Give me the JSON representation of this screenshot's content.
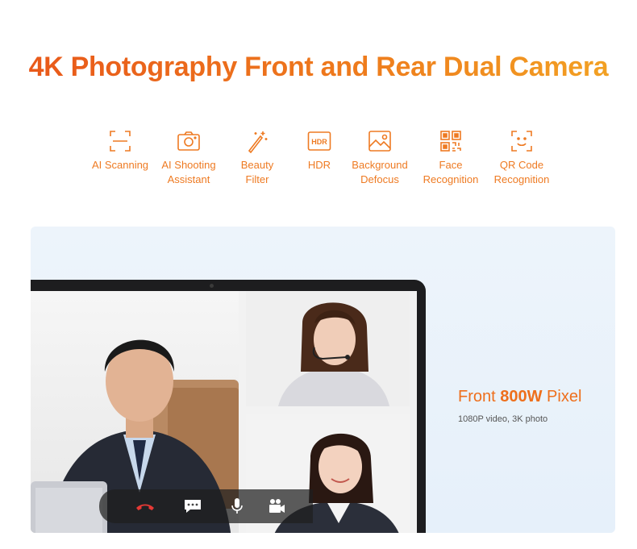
{
  "heading": "4K Photography Front and Rear Dual Camera",
  "features": [
    {
      "line1": "AI Scanning",
      "line2": "",
      "icon": "scan-frame-icon"
    },
    {
      "line1": "AI Shooting",
      "line2": "Assistant",
      "icon": "camera-icon"
    },
    {
      "line1": "Beauty",
      "line2": "Filter",
      "icon": "magic-wand-icon"
    },
    {
      "line1": "HDR",
      "line2": "",
      "icon": "hdr-icon"
    },
    {
      "line1": "Background",
      "line2": "Defocus",
      "icon": "landscape-photo-icon"
    },
    {
      "line1": "Face",
      "line2": "Recognition",
      "icon": "qr-grid-icon"
    },
    {
      "line1": "QR Code",
      "line2": "Recognition",
      "icon": "face-frame-icon"
    }
  ],
  "hdr_icon_text": "HDR",
  "front_camera": {
    "title_light": "Front ",
    "title_bold": "800W",
    "title_end": " Pixel",
    "subtitle": "1080P video, 3K photo"
  },
  "call_controls": [
    "hang-up-icon",
    "chat-icon",
    "microphone-icon",
    "video-camera-icon"
  ],
  "colors": {
    "accent": "#ee7a22",
    "accent_start": "#e8561a",
    "accent_end": "#f3a524",
    "hangup": "#e53935"
  }
}
